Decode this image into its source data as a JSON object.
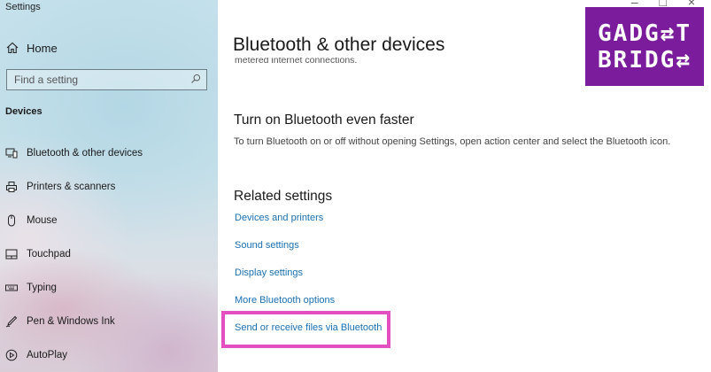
{
  "window": {
    "title": "Settings"
  },
  "sidebar": {
    "home_label": "Home",
    "search_placeholder": "Find a setting",
    "section_heading": "Devices",
    "items": [
      {
        "label": "Bluetooth & other devices",
        "icon": "bluetooth-devices-icon"
      },
      {
        "label": "Printers & scanners",
        "icon": "printer-icon"
      },
      {
        "label": "Mouse",
        "icon": "mouse-icon"
      },
      {
        "label": "Touchpad",
        "icon": "touchpad-icon"
      },
      {
        "label": "Typing",
        "icon": "keyboard-icon"
      },
      {
        "label": "Pen & Windows Ink",
        "icon": "pen-icon"
      },
      {
        "label": "AutoPlay",
        "icon": "autoplay-icon"
      }
    ]
  },
  "main": {
    "page_title": "Bluetooth & other devices",
    "cut_text": "metered internet connections.",
    "faster_heading": "Turn on Bluetooth even faster",
    "faster_desc": "To turn Bluetooth on or off without opening Settings, open action center and select the Bluetooth icon.",
    "related_heading": "Related settings",
    "links": [
      "Devices and printers",
      "Sound settings",
      "Display settings",
      "More Bluetooth options",
      "Send or receive files via Bluetooth"
    ],
    "highlighted_link_index": 4
  },
  "watermark": {
    "line1": "GADG",
    "line1_end": "T",
    "line2": "BRIDG"
  },
  "colors": {
    "link": "#1a6fb0",
    "highlight": "#e34fc0",
    "logo_bg": "#7a1c9c"
  }
}
